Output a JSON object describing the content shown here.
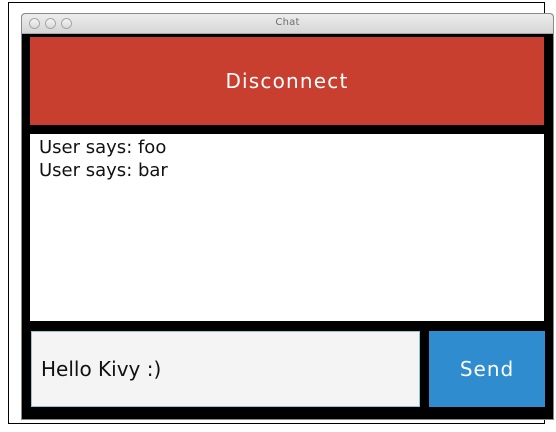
{
  "window": {
    "title": "Chat"
  },
  "toolbar": {
    "disconnect_label": "Disconnect"
  },
  "chat": {
    "messages": [
      "User says: foo",
      "User says: bar"
    ]
  },
  "composer": {
    "input_value": "Hello Kivy :)",
    "send_label": "Send"
  },
  "colors": {
    "disconnect_bg": "#c83f30",
    "send_bg": "#2f8ccf",
    "chat_bg": "#ffffff",
    "input_bg": "#f4f4f4",
    "window_bg": "#000000"
  },
  "icons": {
    "window_controls": [
      "close-icon",
      "minimize-icon",
      "zoom-icon"
    ]
  }
}
